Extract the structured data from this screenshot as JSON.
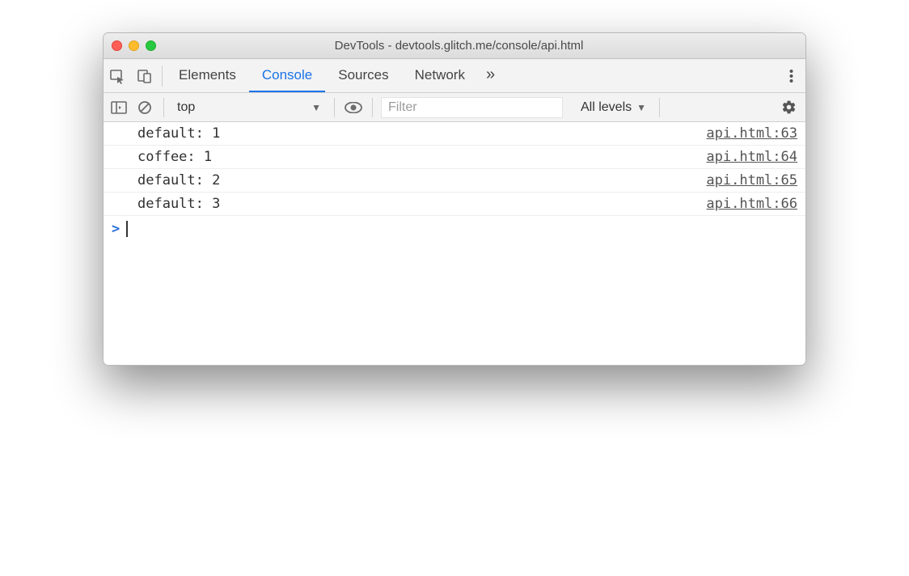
{
  "window": {
    "title": "DevTools - devtools.glitch.me/console/api.html"
  },
  "tabs": {
    "items": [
      {
        "label": "Elements",
        "active": false
      },
      {
        "label": "Console",
        "active": true
      },
      {
        "label": "Sources",
        "active": false
      },
      {
        "label": "Network",
        "active": false
      }
    ],
    "more_glyph": "»"
  },
  "console_toolbar": {
    "context": "top",
    "filter_placeholder": "Filter",
    "levels_label": "All levels"
  },
  "logs": [
    {
      "message": "default: 1",
      "source": "api.html:63"
    },
    {
      "message": "coffee: 1",
      "source": "api.html:64"
    },
    {
      "message": "default: 2",
      "source": "api.html:65"
    },
    {
      "message": "default: 3",
      "source": "api.html:66"
    }
  ],
  "prompt": {
    "chevron": ">"
  }
}
